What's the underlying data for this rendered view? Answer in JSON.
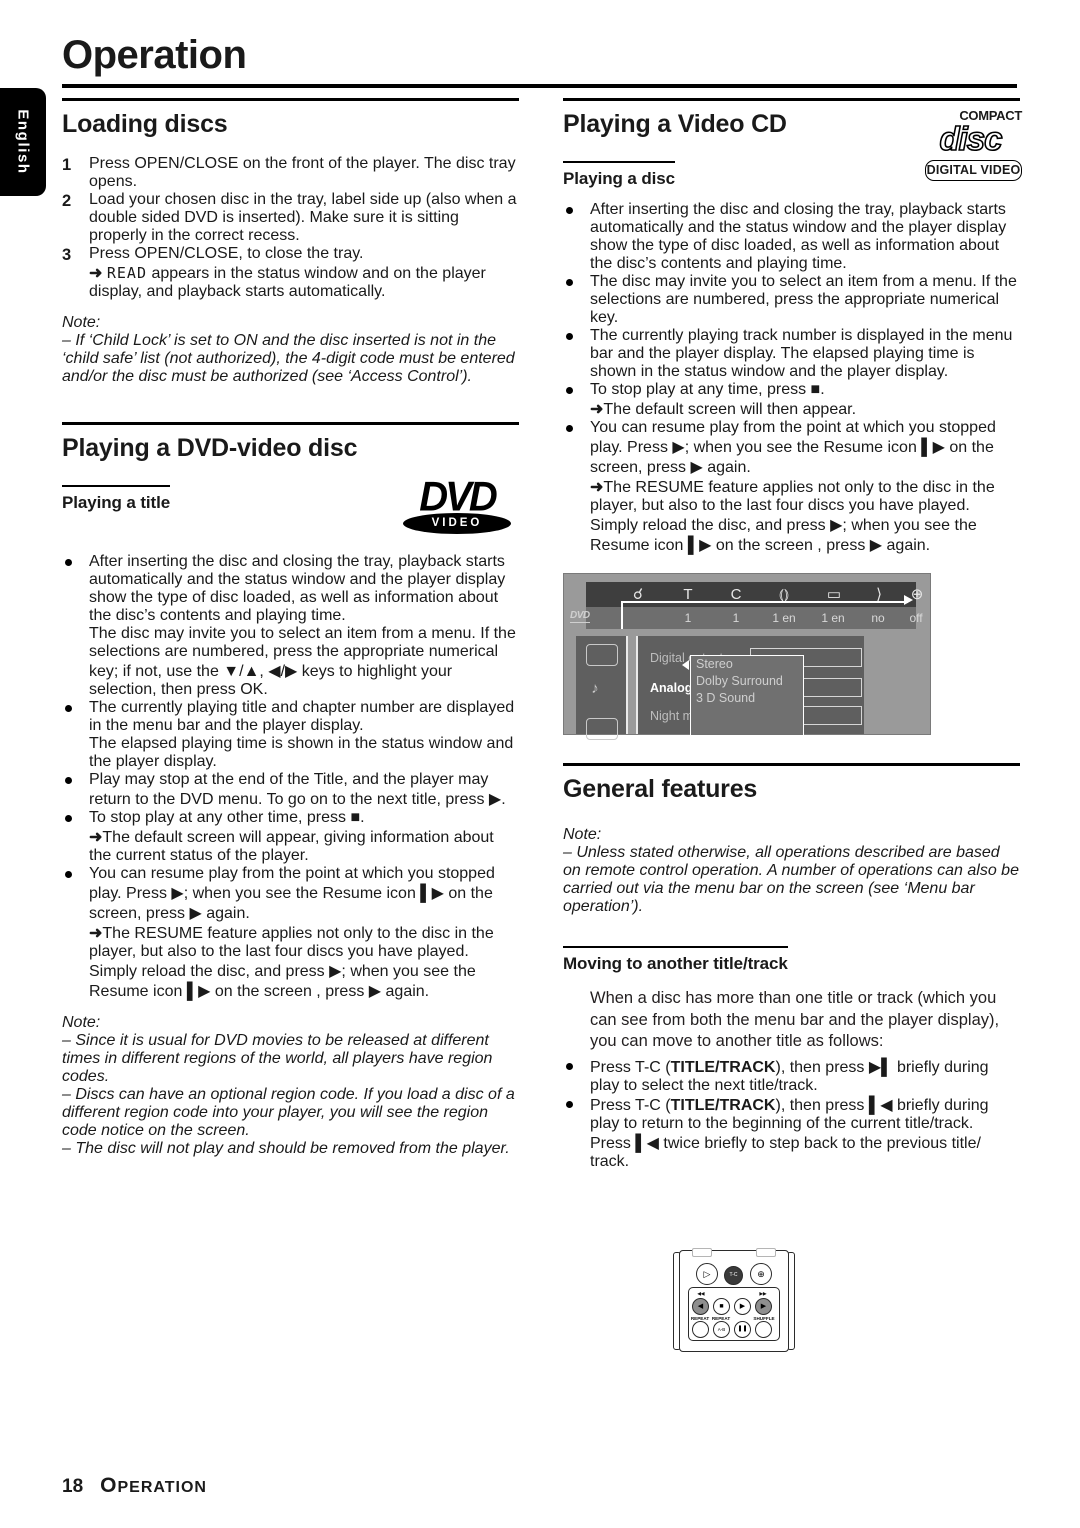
{
  "page": {
    "title": "Operation",
    "language_tab": "English",
    "footer_page_number": "18",
    "footer_section": "OPERATION",
    "footer_section_first": "O",
    "footer_section_rest": "PERATION"
  },
  "left_column": {
    "loading_discs": {
      "heading": "Loading discs",
      "steps": [
        {
          "n": "1",
          "text": "Press OPEN/CLOSE on the front of the player. The disc tray opens."
        },
        {
          "n": "2",
          "text": "Load your chosen disc in the tray, label side up (also when a double sided DVD is inserted). Make sure it is sitting properly in the correct recess."
        },
        {
          "n": "3",
          "text": "Press OPEN/CLOSE, to close the tray."
        }
      ],
      "step3_arrow_pre": "appears in the status window and on the player display, and playback starts automatically.",
      "step3_lcd": "READ",
      "note_label": "Note:",
      "note_text": "–  If ‘Child Lock’ is set to ON and the disc inserted is not in the ‘child safe’ list (not authorized), the 4-digit code must be entered and/or the disc must be authorized (see ‘Access Control’)."
    },
    "dvd_video": {
      "heading": "Playing a DVD-video disc",
      "subheading": "Playing a title",
      "logo": {
        "word": "DVD",
        "sub": "VIDEO"
      },
      "bullets": [
        "After inserting the disc and closing the tray, playback starts automatically and the status window and the player display show the type of disc loaded, as well as information about the disc’s contents and playing time.\nThe disc may invite you to select an item from a menu. If the selections are numbered, press the appropriate numerical key; if not, use the ▼/▲, ◀/▶ keys to highlight your selection, then press OK.",
        "The currently playing title and chapter number are displayed in the menu bar and the player display.\nThe elapsed playing time is shown in the status window and the player display.",
        "Play may stop at the end of the Title, and the player may return to the DVD menu. To go on to the next title, press ▶."
      ],
      "stop_bullet": "To stop play at any other time, press ■.",
      "stop_arrow": "The default screen will appear, giving information about the current status of the player.",
      "resume_bullet": "You can resume play from the point at which you stopped play. Press ▶; when you see the Resume icon ▌▶ on the screen, press ▶ again.",
      "resume_arrow": "The RESUME feature applies not only to the disc in the player, but also to the last four discs you have played. Simply reload the disc, and press ▶; when you see the Resume icon ▌▶ on the screen , press ▶ again.",
      "note_label": "Note:",
      "notes": [
        "–  Since it is usual for DVD movies to be released at different times in different regions of the world, all players have region codes.",
        "–  Discs can have an optional region code. If you load a disc of a different region code into your player, you will see the region code notice on the screen.",
        "–  The disc will not play and should be removed from the player."
      ]
    }
  },
  "right_column": {
    "video_cd": {
      "heading": "Playing a Video CD",
      "subheading": "Playing a disc",
      "logo": {
        "compact": "COMPACT",
        "disc": "disc",
        "digital_video": "DIGITAL VIDEO"
      },
      "bullets": [
        "After inserting the disc and closing the tray, playback starts automatically and the status window and the player display show the type of disc loaded, as well as information about the disc’s contents and playing time.",
        "The disc may invite you to select an item from a menu. If the selections are numbered, press the appropriate numerical key.",
        "The currently playing track number is displayed in the menu bar and the player display. The elapsed playing time is shown in the status window and the player display."
      ],
      "stop_bullet": "To stop play at any time, press ■.",
      "stop_arrow": "The default screen will then appear.",
      "resume_bullet": "You can resume play from the point at which you stopped play. Press ▶; when you see the Resume icon ▌▶ on the screen, press ▶ again.",
      "resume_arrow": "The RESUME feature applies not only to the disc in the player, but also to the last four discs you have played. Simply reload the disc, and press ▶; when you see the Resume icon ▌▶ on the screen , press ▶ again."
    },
    "osd_screenshot": {
      "disc_tag": "DVD",
      "menu_icons": [
        "disc-pointer",
        "T",
        "C",
        "audio",
        "subtitle",
        "angle",
        "zoom"
      ],
      "menu_values": [
        "1",
        "1",
        "1 en",
        "1 en",
        "no",
        "off"
      ],
      "sidebar_icons": [
        "picture",
        "audio-note",
        "feature"
      ],
      "settings_rows": [
        {
          "label": "Digital output",
          "selected": false
        },
        {
          "label": "Analog output",
          "selected": true
        },
        {
          "label": "Night mode",
          "selected": false
        }
      ],
      "dropdown_options": [
        "Stereo",
        "Dolby Surround",
        "3 D Sound"
      ]
    },
    "general_features": {
      "heading": "General features",
      "note_label": "Note:",
      "note_text": "–  Unless stated otherwise, all operations described are based on remote control operation. A number of operations can also be carried out via the menu bar on the screen (see ‘Menu bar operation’).",
      "subheading": "Moving to another title/track",
      "intro": "When a disc has more than one title or track (which you can see from both the menu bar and the player display), you can move to another title as follows:",
      "bullets": [
        {
          "pre": "Press T-C (",
          "strong": "TITLE/TRACK",
          "post": "), then press ▶▌ briefly during play to select the next title/track."
        },
        {
          "pre": "Press T-C (",
          "strong": "TITLE/TRACK",
          "post": "), then press ▌◀ briefly during play to return to the beginning of the current title/track.\nPress ▌◀ twice briefly to step back to the previous title/ track."
        }
      ]
    },
    "remote": {
      "tc_label": "T-C",
      "buttons": [
        "angle",
        "zoom",
        "previous",
        "stop",
        "play",
        "next",
        "repeat",
        "repeat-ab",
        "pause",
        "shuffle"
      ],
      "labels": [
        "REPEAT",
        "REPEAT",
        "SHUFFLE",
        "A-B"
      ],
      "rewind_mark": "◀◀",
      "forward_mark": "▶▶"
    }
  }
}
